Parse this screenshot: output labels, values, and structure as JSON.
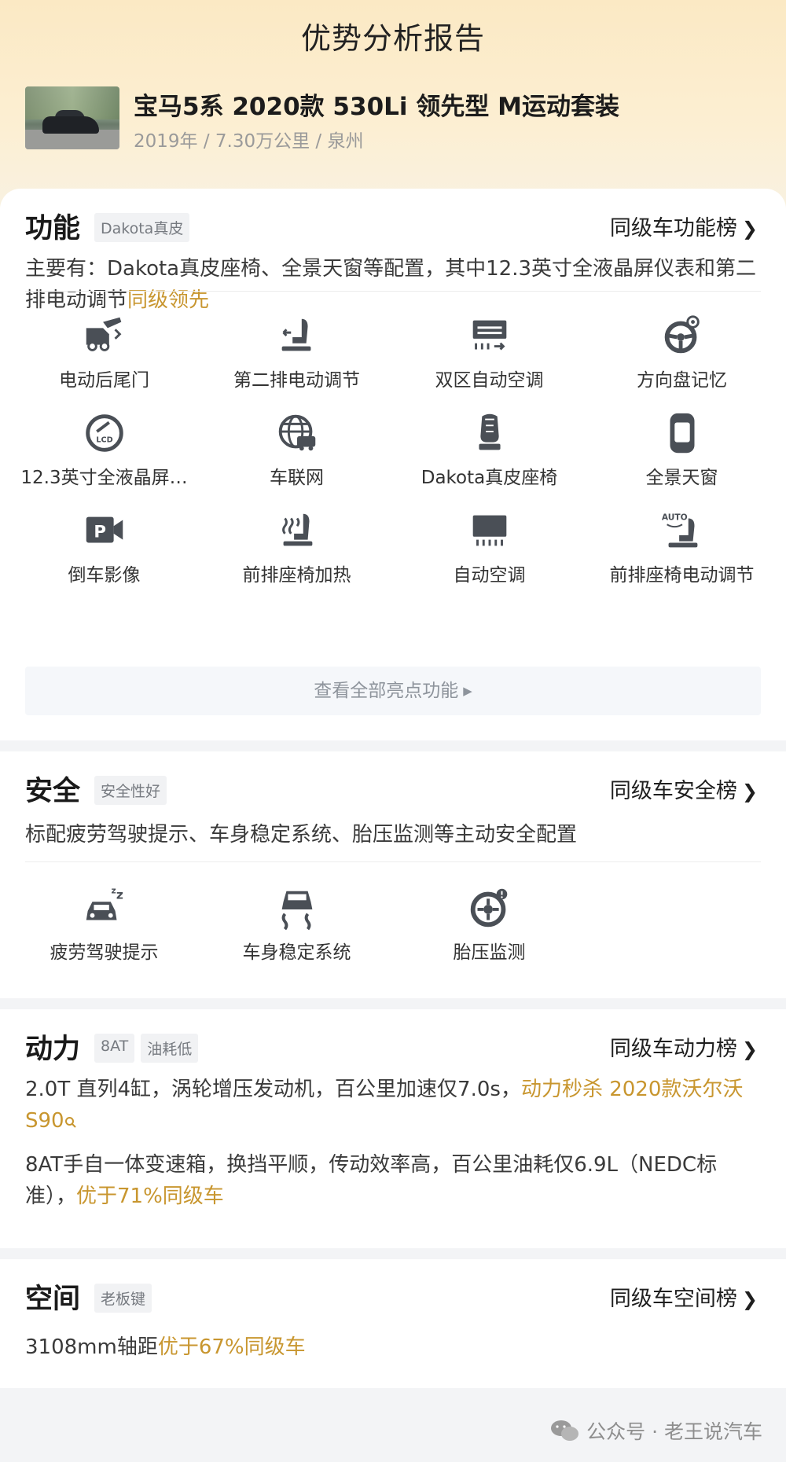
{
  "header": {
    "title": "优势分析报告",
    "car_name": "宝马5系 2020款 530Li 领先型 M运动套装",
    "car_meta": "2019年 / 7.30万公里 / 泉州"
  },
  "function": {
    "title": "功能",
    "tags": [
      "Dakota真皮"
    ],
    "rank_label": "同级车功能榜",
    "desc_prefix": "主要有：Dakota真皮座椅、全景天窗等配置，其中12.3英寸全液晶屏仪表和第二排电动调节",
    "desc_highlight": "同级领先",
    "features": [
      {
        "label": "电动后尾门",
        "icon": "power-tailgate-icon"
      },
      {
        "label": "第二排电动调节",
        "icon": "second-row-seat-icon"
      },
      {
        "label": "双区自动空调",
        "icon": "dual-zone-ac-icon"
      },
      {
        "label": "方向盘记忆",
        "icon": "steering-memory-icon"
      },
      {
        "label": "12.3英寸全液晶屏…",
        "icon": "lcd-gauge-icon"
      },
      {
        "label": "车联网",
        "icon": "connected-car-icon"
      },
      {
        "label": "Dakota真皮座椅",
        "icon": "leather-seat-icon"
      },
      {
        "label": "全景天窗",
        "icon": "panoramic-sunroof-icon"
      },
      {
        "label": "倒车影像",
        "icon": "reverse-camera-icon"
      },
      {
        "label": "前排座椅加热",
        "icon": "seat-heating-icon"
      },
      {
        "label": "自动空调",
        "icon": "auto-ac-icon"
      },
      {
        "label": "前排座椅电动调节",
        "icon": "power-front-seat-icon"
      }
    ],
    "more_label": "查看全部亮点功能"
  },
  "safety": {
    "title": "安全",
    "tags": [
      "安全性好"
    ],
    "rank_label": "同级车安全榜",
    "desc": "标配疲劳驾驶提示、车身稳定系统、胎压监测等主动安全配置",
    "features": [
      {
        "label": "疲劳驾驶提示",
        "icon": "fatigue-alert-icon"
      },
      {
        "label": "车身稳定系统",
        "icon": "stability-control-icon"
      },
      {
        "label": "胎压监测",
        "icon": "tire-pressure-icon"
      }
    ]
  },
  "power": {
    "title": "动力",
    "tags": [
      "8AT",
      "油耗低"
    ],
    "rank_label": "同级车动力榜",
    "p1_prefix": "2.0T 直列4缸，涡轮增压发动机，百公里加速仅7.0s，",
    "p1_highlight": "动力秒杀 2020款沃尔沃S90",
    "p2_prefix": "8AT手自一体变速箱，换挡平顺，传动效率高，百公里油耗仅6.9L（NEDC标准），",
    "p2_highlight": "优于71%同级车"
  },
  "space": {
    "title": "空间",
    "tags": [
      "老板键"
    ],
    "rank_label": "同级车空间榜",
    "desc_prefix": "3108mm轴距",
    "desc_highlight": "优于67%同级车"
  },
  "watermark": "公众号 · 老王说汽车",
  "colors": {
    "highlight": "#c8962f",
    "icon": "#4a4f56"
  }
}
